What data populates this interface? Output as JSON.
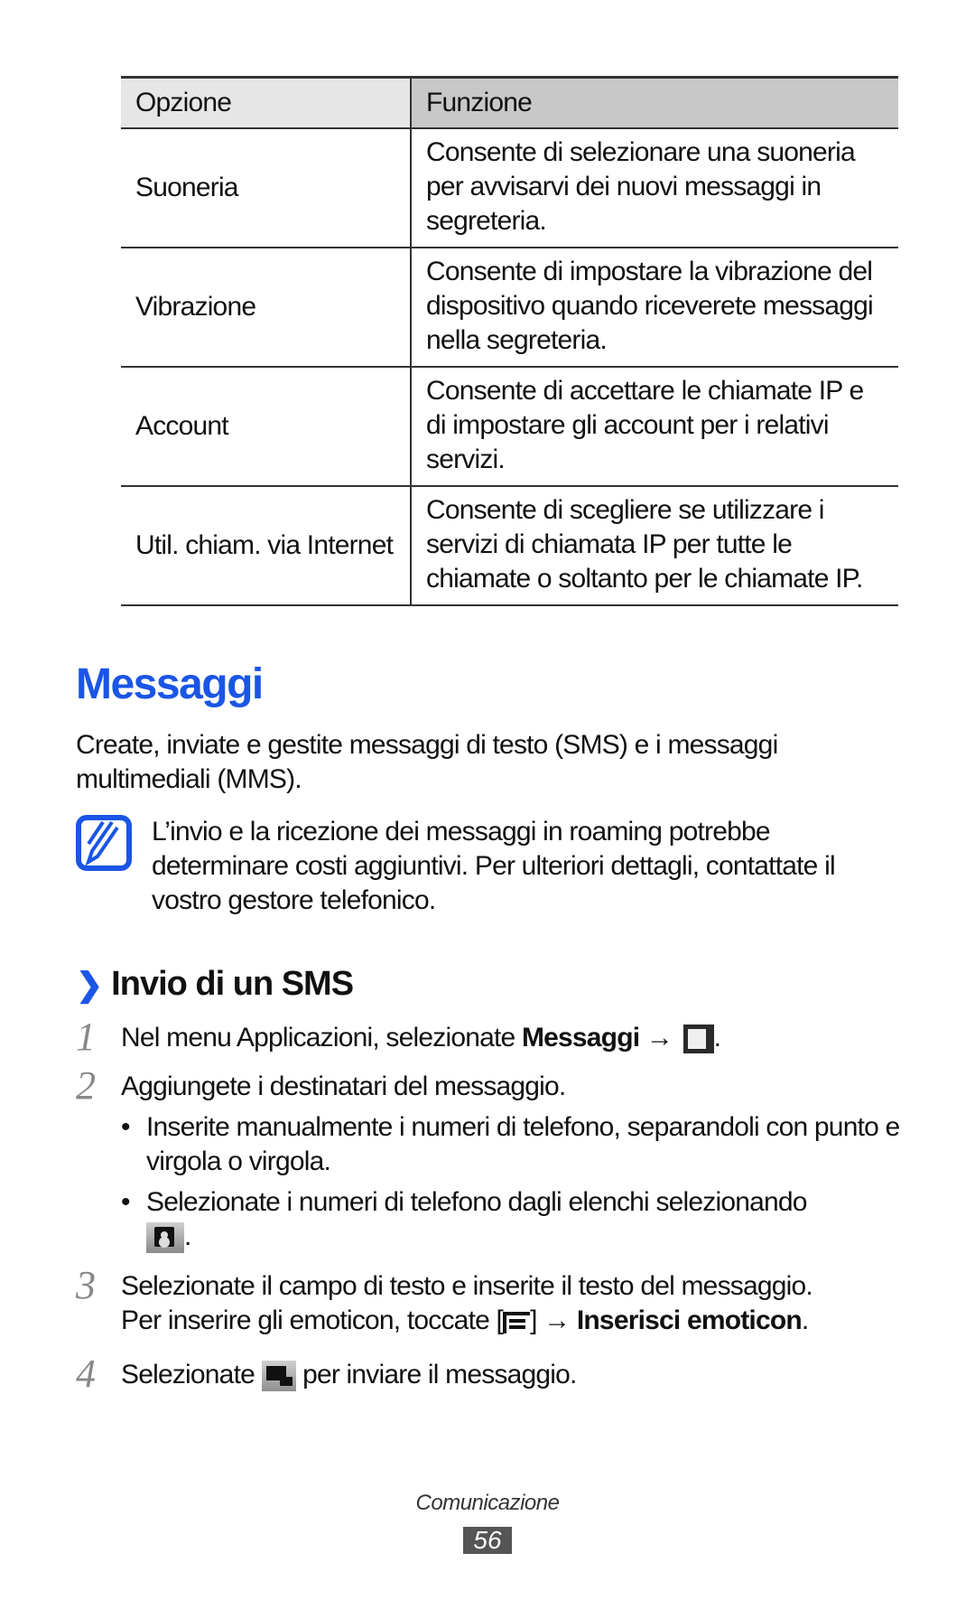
{
  "table": {
    "headers": [
      "Opzione",
      "Funzione"
    ],
    "rows": [
      {
        "option": "Suoneria",
        "function": "Consente di selezionare una suoneria per avvisarvi dei nuovi messaggi in segreteria."
      },
      {
        "option": "Vibrazione",
        "function": "Consente di impostare la vibrazione del dispositivo quando riceverete messaggi nella segreteria."
      },
      {
        "option": "Account",
        "function": "Consente di accettare le chiamate IP e di impostare gli account per i relativi servizi."
      },
      {
        "option": "Util. chiam. via Internet",
        "function": "Consente di scegliere se utilizzare i servizi di chiamata IP per tutte le chiamate o soltanto per le chiamate IP."
      }
    ]
  },
  "section": {
    "title": "Messaggi",
    "intro": "Create, inviate e gestite messaggi di testo (SMS) e i messaggi multimediali (MMS).",
    "note": {
      "icon": "note-pencil-icon",
      "text": "L’invio e la ricezione dei messaggi in roaming potrebbe determinare costi aggiuntivi. Per ulteriori dettagli, contattate il vostro gestore telefonico."
    }
  },
  "subsection": {
    "chevron": "❯",
    "title": "Invio di un SMS",
    "steps": [
      {
        "num": "1",
        "text_before": "Nel menu Applicazioni, selezionate ",
        "bold": "Messaggi",
        "arrow": "→",
        "icon": "compose-icon",
        "text_after": "."
      },
      {
        "num": "2",
        "text": "Aggiungete i destinatari del messaggio.",
        "bullets": [
          {
            "text": "Inserite manualmente i numeri di telefono, separandoli con punto e virgola o virgola."
          },
          {
            "text": "Selezionate i numeri di telefono dagli elenchi selezionando",
            "icon": "contact-icon",
            "text_after": "."
          }
        ]
      },
      {
        "num": "3",
        "text": "Selezionate il campo di testo e inserite il testo del messaggio.",
        "text2_before": "Per inserire gli emoticon, toccate [",
        "icon": "menu-icon",
        "text2_mid": "] → ",
        "bold": "Inserisci emoticon",
        "text2_after": "."
      },
      {
        "num": "4",
        "text_before": "Selezionate ",
        "icon": "send-icon",
        "text_after": " per inviare il messaggio."
      }
    ]
  },
  "footer": {
    "chapter": "Comunicazione",
    "page_number": "56"
  },
  "colors": {
    "accent": "#1a55e6",
    "header_left": "#e6e6e6",
    "header_right": "#c8c8c8",
    "page_badge": "#555555"
  }
}
